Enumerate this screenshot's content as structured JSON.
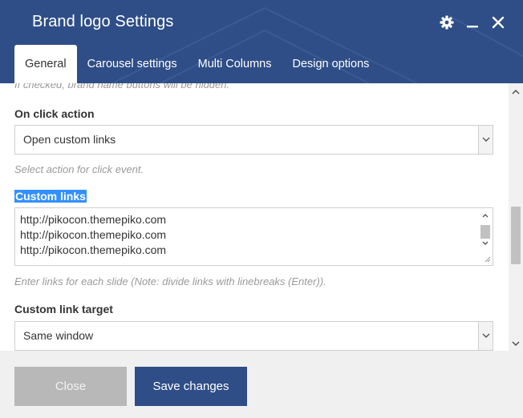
{
  "dialog": {
    "title": "Brand logo Settings"
  },
  "header_icons": [
    "gear-icon",
    "minimize-icon",
    "close-icon"
  ],
  "tabs": [
    {
      "label": "General",
      "active": true
    },
    {
      "label": "Carousel settings",
      "active": false
    },
    {
      "label": "Multi Columns",
      "active": false
    },
    {
      "label": "Design options",
      "active": false
    }
  ],
  "form": {
    "hide_names_hint": "If checked, brand name buttons will be hidden.",
    "on_click": {
      "label": "On click action",
      "value": "Open custom links",
      "hint": "Select action for click event."
    },
    "custom_links": {
      "label": "Custom links",
      "lines": [
        "http://pikocon.themepiko.com",
        "http://pikocon.themepiko.com",
        "http://pikocon.themepiko.com"
      ],
      "hint": "Enter links for each slide (Note: divide links with linebreaks (Enter))."
    },
    "link_target": {
      "label": "Custom link target",
      "value": "Same window"
    }
  },
  "footer": {
    "close_label": "Close",
    "save_label": "Save changes"
  },
  "colors": {
    "header": "#2f4e87",
    "save_button": "#2f4e87",
    "close_button": "#b8b8b8",
    "selection": "#3390ff",
    "footer": "#f0f0f0"
  }
}
